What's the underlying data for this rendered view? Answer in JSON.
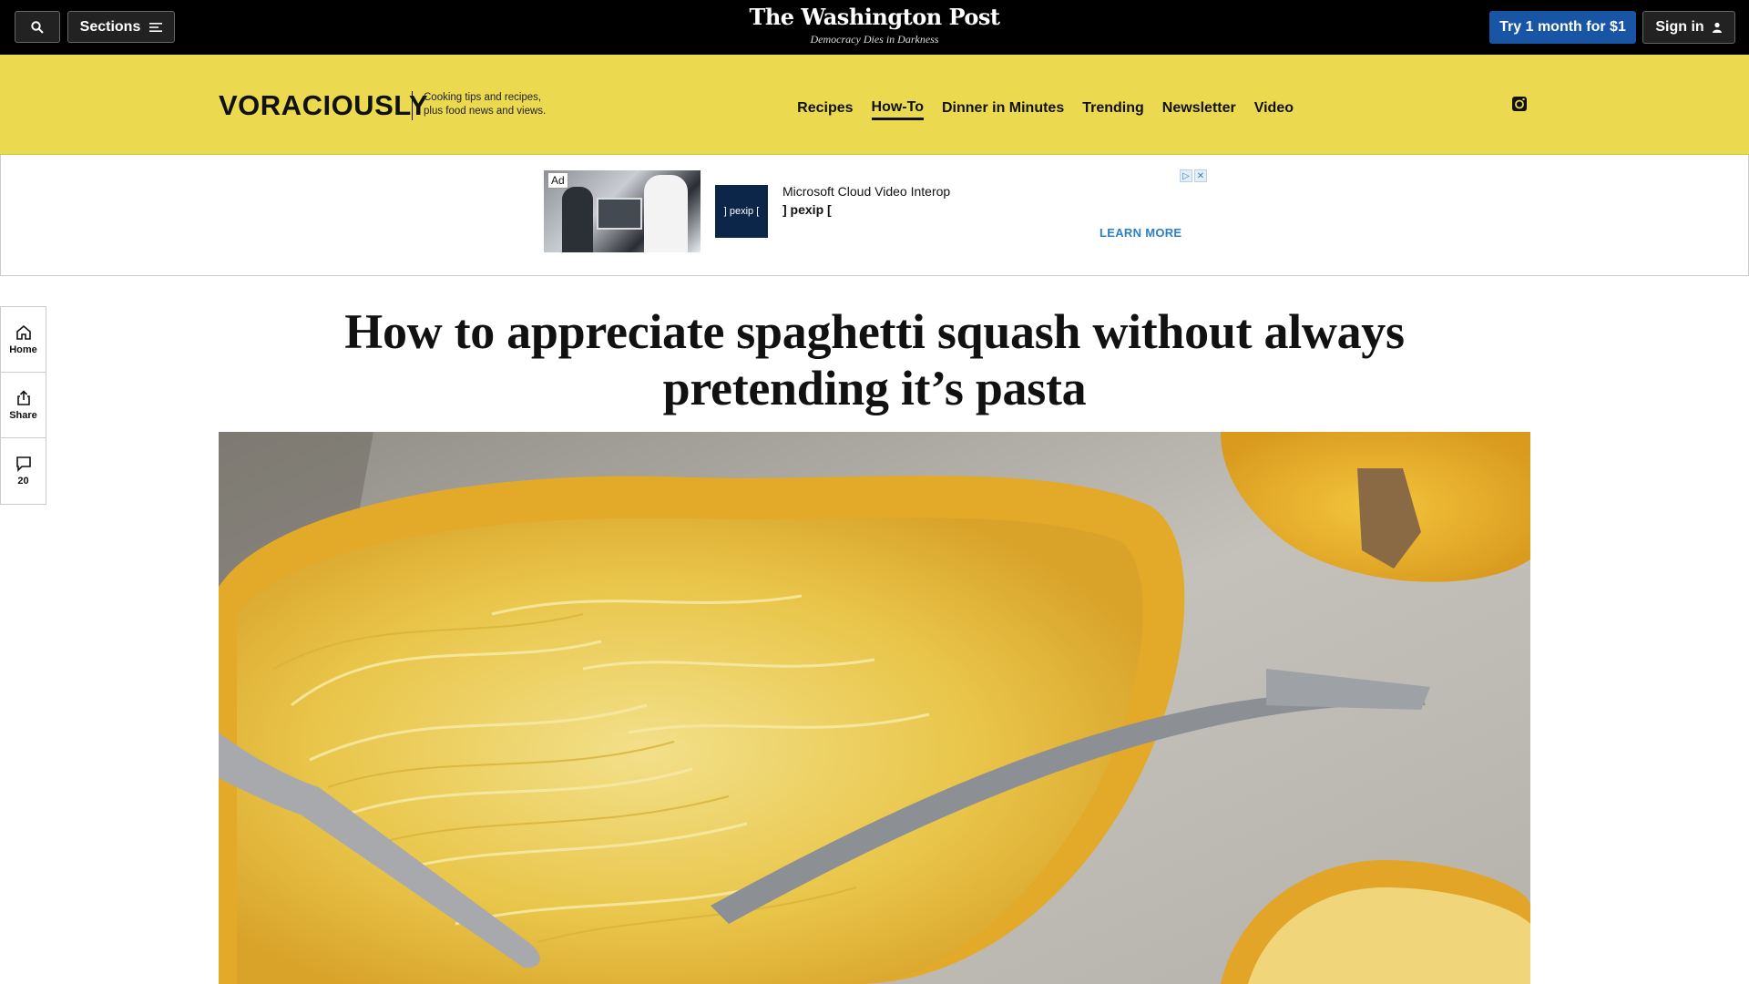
{
  "topbar": {
    "sections_label": "Sections",
    "publication_name": "The Washington Post",
    "tagline": "Democracy Dies in Darkness",
    "subscribe_label": "Try 1 month for $1",
    "signin_label": "Sign in"
  },
  "voraciously": {
    "logo": "VORACIOUSLY",
    "tagline": "Cooking tips and recipes, plus food news and views.",
    "nav": [
      {
        "label": "Recipes"
      },
      {
        "label": "How-To",
        "active": true
      },
      {
        "label": "Dinner in Minutes"
      },
      {
        "label": "Trending"
      },
      {
        "label": "Newsletter"
      },
      {
        "label": "Video"
      }
    ]
  },
  "ad": {
    "label": "Ad",
    "logo_text": "] pexip [",
    "title": "Microsoft Cloud Video Interop",
    "brand": "] pexip [",
    "cta": "LEARN MORE"
  },
  "rail": {
    "home_label": "Home",
    "share_label": "Share",
    "comments_count": "20"
  },
  "article": {
    "headline": "How to appreciate spaghetti squash without always pretending it’s pasta"
  },
  "colors": {
    "topbar_bg": "#000000",
    "header_yellow": "#ebd94f",
    "subscribe_blue": "#1955a5",
    "ad_cta_blue": "#2a80c5"
  }
}
